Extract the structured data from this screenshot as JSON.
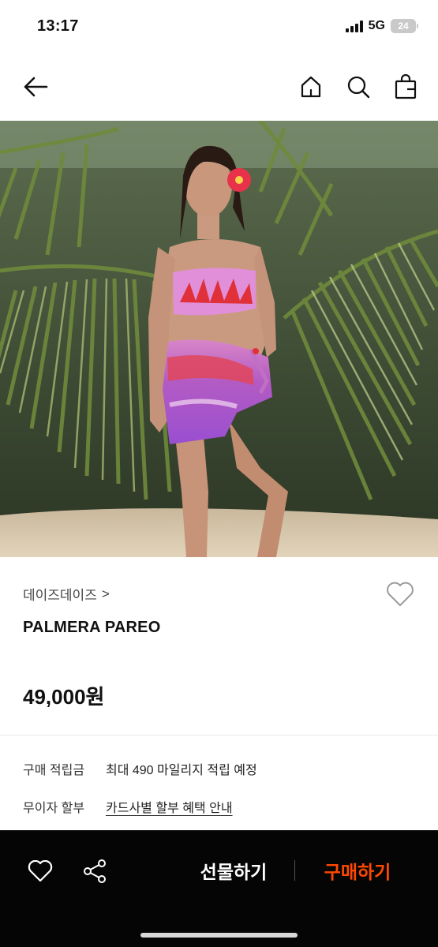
{
  "status_bar": {
    "time": "13:17",
    "network": "5G",
    "battery": "24"
  },
  "nav": {
    "icons": [
      "back-arrow-icon",
      "home-icon",
      "search-icon",
      "shopping-bag-icon"
    ]
  },
  "hero": {
    "image": "product photo: model wearing pink bandeau top and pink palm-print pareo in front of palm fronds"
  },
  "product": {
    "brand": "데이즈데이즈",
    "brand_chevron": ">",
    "name": "PALMERA PAREO",
    "price": "49,000원"
  },
  "info": {
    "points_label": "구매 적립금",
    "points_value": "최대 490 마일리지 적립 예정",
    "installment_label": "무이자 할부",
    "installment_link": "카드사별 할부 혜택 안내"
  },
  "actions": {
    "gift_label": "선물하기",
    "buy_label": "구매하기",
    "accent": "#ff4800",
    "bar_color": "#050505"
  }
}
